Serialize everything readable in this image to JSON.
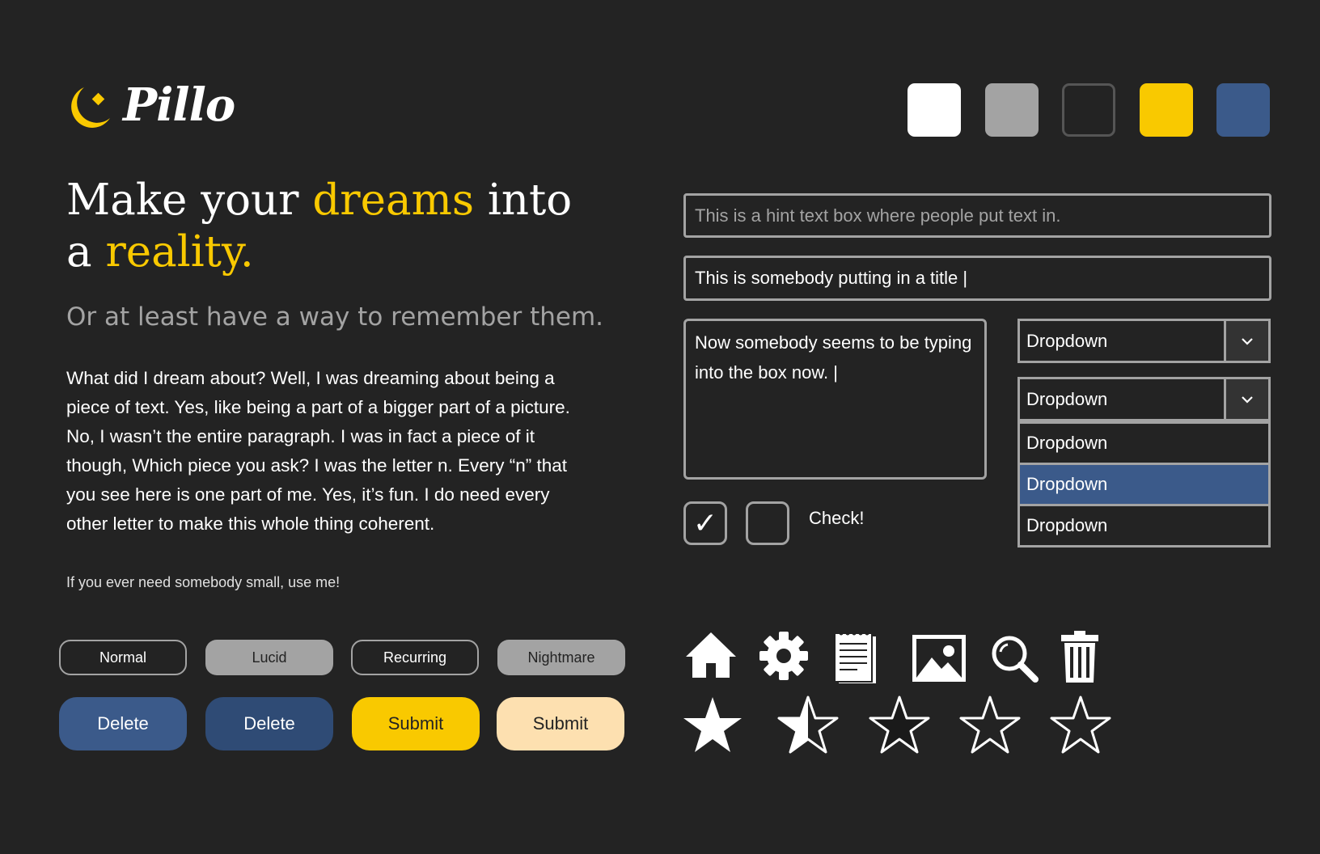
{
  "brand": {
    "name": "Pillo"
  },
  "palette": [
    "#ffffff",
    "#a3a3a3",
    "#232323",
    "#f9c900",
    "#3b5a8a"
  ],
  "hero": {
    "headline_part1": "Make your ",
    "headline_accent1": "dreams",
    "headline_part2": " into a ",
    "headline_accent2": "reality.",
    "subheading": "Or at least have a way to remember them.",
    "body": "What did I dream about? Well, I was dreaming about being a piece of text. Yes, like being a part of a bigger part of a picture. No, I wasn’t the entire paragraph. I was in fact a piece of it though, Which piece you ask? I was the letter n. Every “n” that you see here is one part of me. Yes, it’s fun. I do need every other letter to make this whole thing coherent.",
    "small": "If you ever need somebody small, use me!"
  },
  "tags": [
    "Normal",
    "Lucid",
    "Recurring",
    "Nightmare"
  ],
  "buttons": [
    "Delete",
    "Delete",
    "Submit",
    "Submit"
  ],
  "inputs": {
    "hint_placeholder": "This is a hint text box where people put text in.",
    "title_value": "This is somebody putting in a title |",
    "textarea_value": "Now somebody seems to be typing into the box now. |"
  },
  "checkboxes": {
    "checked_mark": "✓",
    "label": "Check!"
  },
  "dropdowns": {
    "closed_label": "Dropdown",
    "open_label": "Dropdown",
    "options": [
      "Dropdown",
      "Dropdown",
      "Dropdown"
    ],
    "selected_index": 1,
    "arrow": "v"
  },
  "icons": [
    "home-icon",
    "gear-icon",
    "notepad-icon",
    "image-icon",
    "search-icon",
    "trash-icon"
  ],
  "rating": {
    "filled": 1.5,
    "max": 5
  }
}
